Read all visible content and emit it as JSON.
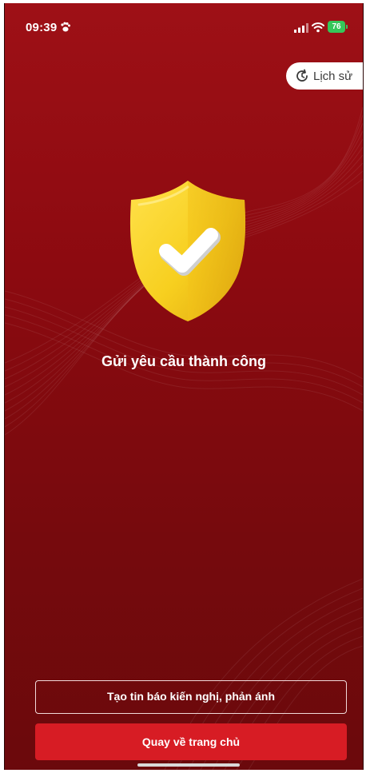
{
  "status_bar": {
    "time": "09:39",
    "battery": "76"
  },
  "header": {
    "history_label": "Lịch sử"
  },
  "main": {
    "success_message": "Gửi yêu cầu thành công"
  },
  "actions": {
    "create_report_label": "Tạo tin báo kiến nghị, phản ánh",
    "back_home_label": "Quay về trang chủ"
  },
  "icons": {
    "status_extra": "paw-icon",
    "signal": "signal-icon",
    "wifi": "wifi-icon",
    "history": "history-icon",
    "hero": "shield-check-icon"
  },
  "colors": {
    "background": "#8c0a10",
    "primary_button": "#d71c24",
    "shield_yellow": "#f7cf1f",
    "battery_green": "#35c759"
  }
}
